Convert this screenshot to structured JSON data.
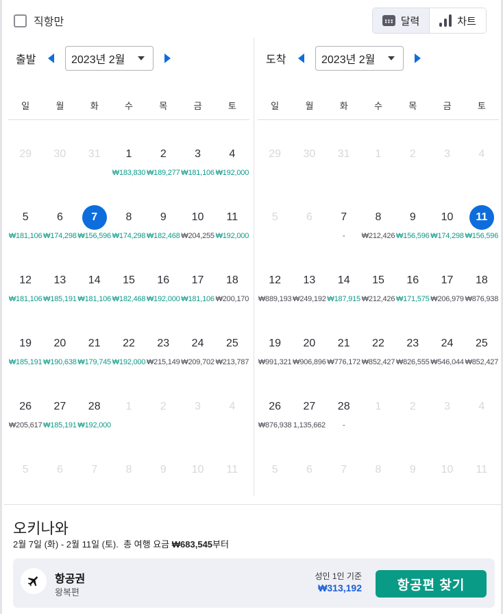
{
  "filters": {
    "direct_only_label": "직항만",
    "direct_only_checked": false
  },
  "view_toggle": [
    {
      "label": "달력",
      "icon": "calendar-icon",
      "active": true
    },
    {
      "label": "차트",
      "icon": "bar-chart-icon",
      "active": false
    }
  ],
  "weekdays": [
    "일",
    "월",
    "화",
    "수",
    "목",
    "금",
    "토"
  ],
  "departure": {
    "label": "출발",
    "month": "2023년 2월",
    "days": [
      {
        "d": "29",
        "disabled": true
      },
      {
        "d": "30",
        "disabled": true
      },
      {
        "d": "31",
        "disabled": true
      },
      {
        "d": "1",
        "price": "₩183,830",
        "tone": "low"
      },
      {
        "d": "2",
        "price": "₩189,277",
        "tone": "low"
      },
      {
        "d": "3",
        "price": "₩181,106",
        "tone": "low"
      },
      {
        "d": "4",
        "price": "₩192,000",
        "tone": "low"
      },
      {
        "d": "5",
        "price": "₩181,106",
        "tone": "low"
      },
      {
        "d": "6",
        "price": "₩174,298",
        "tone": "low"
      },
      {
        "d": "7",
        "price": "₩156,596",
        "tone": "low",
        "selected": true
      },
      {
        "d": "8",
        "price": "₩174,298",
        "tone": "low"
      },
      {
        "d": "9",
        "price": "₩182,468",
        "tone": "low"
      },
      {
        "d": "10",
        "price": "₩204,255",
        "tone": "high"
      },
      {
        "d": "11",
        "price": "₩192,000",
        "tone": "low"
      },
      {
        "d": "12",
        "price": "₩181,106",
        "tone": "low"
      },
      {
        "d": "13",
        "price": "₩185,191",
        "tone": "low"
      },
      {
        "d": "14",
        "price": "₩181,106",
        "tone": "low"
      },
      {
        "d": "15",
        "price": "₩182,468",
        "tone": "low"
      },
      {
        "d": "16",
        "price": "₩192,000",
        "tone": "low"
      },
      {
        "d": "17",
        "price": "₩181,106",
        "tone": "low"
      },
      {
        "d": "18",
        "price": "₩200,170",
        "tone": "high"
      },
      {
        "d": "19",
        "price": "₩185,191",
        "tone": "low"
      },
      {
        "d": "20",
        "price": "₩190,638",
        "tone": "low"
      },
      {
        "d": "21",
        "price": "₩179,745",
        "tone": "low"
      },
      {
        "d": "22",
        "price": "₩192,000",
        "tone": "low"
      },
      {
        "d": "23",
        "price": "₩215,149",
        "tone": "high"
      },
      {
        "d": "24",
        "price": "₩209,702",
        "tone": "high"
      },
      {
        "d": "25",
        "price": "₩213,787",
        "tone": "high"
      },
      {
        "d": "26",
        "price": "₩205,617",
        "tone": "high"
      },
      {
        "d": "27",
        "price": "₩185,191",
        "tone": "low"
      },
      {
        "d": "28",
        "price": "₩192,000",
        "tone": "low"
      },
      {
        "d": "1",
        "disabled": true
      },
      {
        "d": "2",
        "disabled": true
      },
      {
        "d": "3",
        "disabled": true
      },
      {
        "d": "4",
        "disabled": true
      },
      {
        "d": "5",
        "disabled": true
      },
      {
        "d": "6",
        "disabled": true
      },
      {
        "d": "7",
        "disabled": true
      },
      {
        "d": "8",
        "disabled": true
      },
      {
        "d": "9",
        "disabled": true
      },
      {
        "d": "10",
        "disabled": true
      },
      {
        "d": "11",
        "disabled": true
      }
    ]
  },
  "arrival": {
    "label": "도착",
    "month": "2023년 2월",
    "days": [
      {
        "d": "29",
        "disabled": true
      },
      {
        "d": "30",
        "disabled": true
      },
      {
        "d": "31",
        "disabled": true
      },
      {
        "d": "1",
        "disabled": true
      },
      {
        "d": "2",
        "disabled": true
      },
      {
        "d": "3",
        "disabled": true
      },
      {
        "d": "4",
        "disabled": true
      },
      {
        "d": "5",
        "disabled": true
      },
      {
        "d": "6",
        "disabled": true
      },
      {
        "d": "7",
        "price": "-",
        "tone": "high"
      },
      {
        "d": "8",
        "price": "₩212,426",
        "tone": "high"
      },
      {
        "d": "9",
        "price": "₩156,596",
        "tone": "low"
      },
      {
        "d": "10",
        "price": "₩174,298",
        "tone": "low"
      },
      {
        "d": "11",
        "price": "₩156,596",
        "tone": "low",
        "selected": true
      },
      {
        "d": "12",
        "price": "₩889,193",
        "tone": "high"
      },
      {
        "d": "13",
        "price": "₩249,192",
        "tone": "high"
      },
      {
        "d": "14",
        "price": "₩187,915",
        "tone": "low"
      },
      {
        "d": "15",
        "price": "₩212,426",
        "tone": "high"
      },
      {
        "d": "16",
        "price": "₩171,575",
        "tone": "low"
      },
      {
        "d": "17",
        "price": "₩206,979",
        "tone": "high"
      },
      {
        "d": "18",
        "price": "₩876,938",
        "tone": "high"
      },
      {
        "d": "19",
        "price": "₩991,321",
        "tone": "high"
      },
      {
        "d": "20",
        "price": "₩906,896",
        "tone": "high"
      },
      {
        "d": "21",
        "price": "₩776,172",
        "tone": "high"
      },
      {
        "d": "22",
        "price": "₩852,427",
        "tone": "high"
      },
      {
        "d": "23",
        "price": "₩826,555",
        "tone": "high"
      },
      {
        "d": "24",
        "price": "₩546,044",
        "tone": "high"
      },
      {
        "d": "25",
        "price": "₩852,427",
        "tone": "high"
      },
      {
        "d": "26",
        "price": "₩876,938",
        "tone": "high"
      },
      {
        "d": "27",
        "price": "1,135,662",
        "tone": "high"
      },
      {
        "d": "28",
        "price": "-",
        "tone": "high"
      },
      {
        "d": "1",
        "disabled": true
      },
      {
        "d": "2",
        "disabled": true
      },
      {
        "d": "3",
        "disabled": true
      },
      {
        "d": "4",
        "disabled": true
      },
      {
        "d": "5",
        "disabled": true
      },
      {
        "d": "6",
        "disabled": true
      },
      {
        "d": "7",
        "disabled": true
      },
      {
        "d": "8",
        "disabled": true
      },
      {
        "d": "9",
        "disabled": true
      },
      {
        "d": "10",
        "disabled": true
      },
      {
        "d": "11",
        "disabled": true
      }
    ]
  },
  "summary": {
    "destination": "오키나와",
    "dates": "2월 7일 (화) - 2월 11일 (토).",
    "total_prefix": "총 여행 요금",
    "total_price": "₩683,545",
    "total_suffix": "부터",
    "card": {
      "title": "항공권",
      "subtitle": "왕복편",
      "per_adult_label": "성인 1인 기준",
      "price": "₩313,192",
      "button_label": "항공편 찾기"
    }
  },
  "colors": {
    "accent_blue": "#0d6ddc",
    "low_price": "#0e9a88",
    "high_price": "#4a4a55",
    "cta_green": "#0a9b86",
    "price_blue": "#1a5ed8"
  }
}
